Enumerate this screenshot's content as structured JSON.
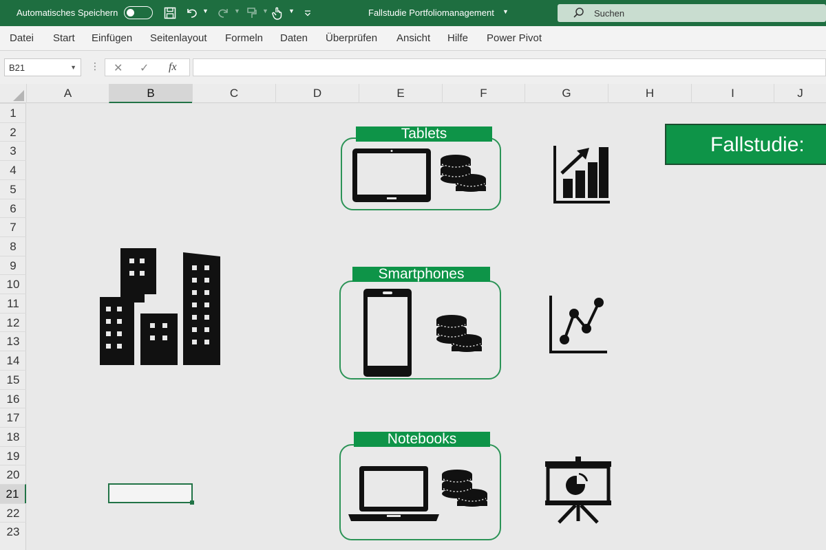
{
  "titlebar": {
    "autosave_label": "Automatisches Speichern",
    "document_title": "Fallstudie Portfoliomanagement",
    "search_placeholder": "Suchen"
  },
  "ribbon": {
    "tabs": [
      "Datei",
      "Start",
      "Einfügen",
      "Seitenlayout",
      "Formeln",
      "Daten",
      "Überprüfen",
      "Ansicht",
      "Hilfe",
      "Power Pivot"
    ]
  },
  "formula_bar": {
    "name_box": "B21",
    "cancel_symbol": "✕",
    "enter_symbol": "✓",
    "function_symbol": "fx"
  },
  "sheet": {
    "columns": [
      "A",
      "B",
      "C",
      "D",
      "E",
      "F",
      "G",
      "H",
      "I",
      "J"
    ],
    "rows": [
      "1",
      "2",
      "3",
      "4",
      "5",
      "6",
      "7",
      "8",
      "9",
      "10",
      "11",
      "12",
      "13",
      "14",
      "15",
      "16",
      "17",
      "18",
      "19",
      "20",
      "21",
      "22",
      "23"
    ],
    "selected_cell": "B21"
  },
  "content": {
    "products": [
      {
        "label": "Tablets",
        "icon": "tablet-icon"
      },
      {
        "label": "Smartphones",
        "icon": "smartphone-icon"
      },
      {
        "label": "Notebooks",
        "icon": "laptop-icon"
      }
    ],
    "banner_text": "Fallstudie:"
  },
  "colors": {
    "titlebar": "#1e6e40",
    "accent": "#0e9448",
    "frame": "#2b9356",
    "icon": "#111111"
  }
}
